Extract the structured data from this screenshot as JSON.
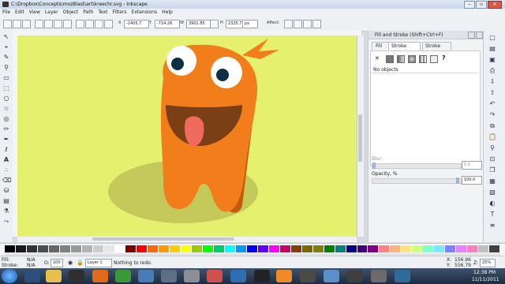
{
  "window": {
    "title": "C:\\Dropbox\\Concepts\\mozBlast\\art\\kreechr.svg - Inkscape"
  },
  "menu": [
    "File",
    "Edit",
    "View",
    "Layer",
    "Object",
    "Path",
    "Text",
    "Filters",
    "Extensions",
    "Help"
  ],
  "tool_controls": {
    "x_label": "X",
    "x_value": "-1405.7",
    "y_label": "Y",
    "y_value": "-714.26",
    "w_label": "W",
    "w_value": "3902.85",
    "h_label": "H",
    "h_value": "2325.71",
    "unit": "px",
    "affect_label": "Affect:"
  },
  "dialog": {
    "title": "Fill and Stroke (Shift+Ctrl+F)",
    "tabs": [
      "Fill",
      "Stroke paint",
      "Stroke style"
    ],
    "no_paint_glyph": "✕",
    "unknown_glyph": "?",
    "status": "No objects",
    "blur_label": "Blur:",
    "blur_value": "0.0",
    "opacity_label": "Opacity, %",
    "opacity_value": "100.0"
  },
  "status": {
    "fill_label": "Fill:",
    "fill_value": "N/A",
    "stroke_label": "Stroke:",
    "stroke_value": "N/A",
    "opacity_label": "O:",
    "opacity_value": "100",
    "layer": "Layer 1",
    "message": "Nothing to redo.",
    "cursor_x_label": "X:",
    "cursor_x": "156.96",
    "cursor_y_label": "Y:",
    "cursor_y": "556.79",
    "zoom_label": "Z:",
    "zoom": "25%"
  },
  "taskbar": {
    "time": "12:38 PM",
    "date": "11/11/2011"
  },
  "colors": {
    "canvas": "#e5f06f",
    "shadow": "#c4c95a",
    "body": "#f27d1b",
    "body_dark": "#c45a0d",
    "mouth": "#7a3f15",
    "tongue": "#f06a5f"
  },
  "palette": [
    "#000000",
    "#1a1a1a",
    "#333333",
    "#4d4d4d",
    "#666666",
    "#808080",
    "#999999",
    "#b3b3b3",
    "#cccccc",
    "#e6e6e6",
    "#ffffff",
    "#800000",
    "#ff0000",
    "#ff6600",
    "#ff9900",
    "#ffcc00",
    "#ffff00",
    "#99cc00",
    "#00ff00",
    "#00cc66",
    "#00ffff",
    "#0099ff",
    "#0000ff",
    "#6600ff",
    "#ff00ff",
    "#cc0066",
    "#804000",
    "#806600",
    "#808000",
    "#008000",
    "#008080",
    "#000080",
    "#400080",
    "#800080",
    "#ff8080",
    "#ffb380",
    "#ffe680",
    "#ccff80",
    "#80ffcc",
    "#80e6ff",
    "#8080ff",
    "#e680ff",
    "#ff80c0",
    "#c0c0c0",
    "#404040"
  ]
}
